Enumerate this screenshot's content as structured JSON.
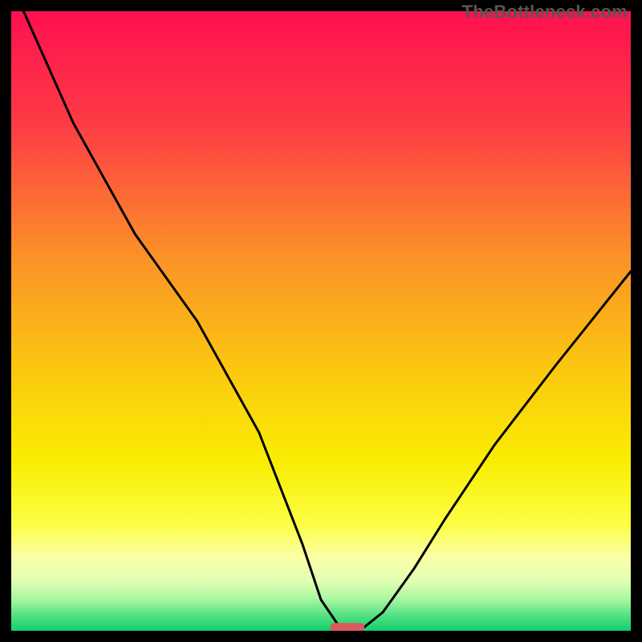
{
  "watermark": "TheBottleneck.com",
  "chart_data": {
    "type": "line",
    "title": "",
    "xlabel": "",
    "ylabel": "",
    "xlim": [
      0,
      100
    ],
    "ylim": [
      0,
      100
    ],
    "grid": false,
    "legend": false,
    "series": [
      {
        "name": "bottleneck-curve",
        "x": [
          2,
          10,
          20,
          30,
          40,
          47,
          50,
          53,
          55,
          57,
          60,
          65,
          70,
          78,
          88,
          100
        ],
        "values": [
          100,
          82,
          64,
          50,
          32,
          14,
          5,
          0.6,
          0.6,
          0.6,
          3,
          10,
          18,
          30,
          43,
          58
        ]
      }
    ],
    "marker": {
      "name": "optimal-marker",
      "x_start": 51.5,
      "x_end": 57,
      "y": 0.55,
      "color": "#d95b5f"
    },
    "background_gradient": {
      "type": "vertical",
      "stops": [
        {
          "y_pct": 0,
          "color": "#fe1050"
        },
        {
          "y_pct": 18,
          "color": "#fd3b45"
        },
        {
          "y_pct": 40,
          "color": "#fb9327"
        },
        {
          "y_pct": 58,
          "color": "#fbc80f"
        },
        {
          "y_pct": 73,
          "color": "#f9ee03"
        },
        {
          "y_pct": 83,
          "color": "#fcff46"
        },
        {
          "y_pct": 88,
          "color": "#fcffa6"
        },
        {
          "y_pct": 92,
          "color": "#e0ffb2"
        },
        {
          "y_pct": 95,
          "color": "#a6f6a0"
        },
        {
          "y_pct": 97.5,
          "color": "#54e184"
        },
        {
          "y_pct": 100,
          "color": "#12cf6e"
        }
      ]
    }
  }
}
